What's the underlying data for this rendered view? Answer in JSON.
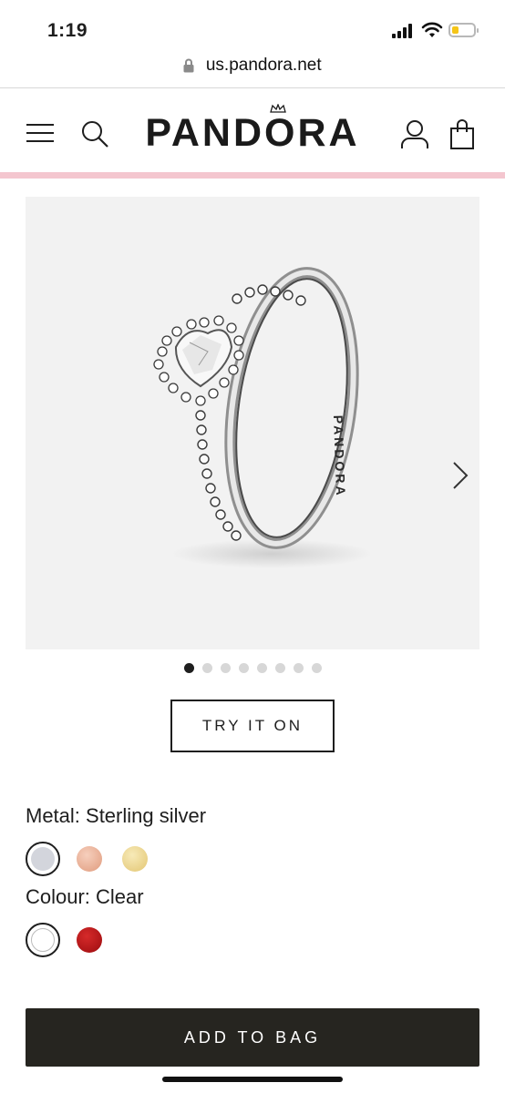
{
  "status_bar": {
    "time": "1:19",
    "battery_color": "#f5c518"
  },
  "browser": {
    "url": "us.pandora.net"
  },
  "header": {
    "logo_text": "PANDORA",
    "icons": [
      "menu-icon",
      "search-icon",
      "account-icon",
      "bag-icon"
    ],
    "accent_line_color": "#f4c6cf"
  },
  "gallery": {
    "image_count": 8,
    "active_index": 0,
    "next_icon": "chevron-right-icon",
    "engraving": "PANDORA"
  },
  "try_on": {
    "label": "TRY IT ON"
  },
  "options": {
    "metal_label": "Metal: Sterling silver",
    "metal_swatches": [
      {
        "name": "sterling-silver",
        "color": "#d3d5dc",
        "selected": true
      },
      {
        "name": "rose-gold",
        "color": "#e5a98e",
        "selected": false
      },
      {
        "name": "gold",
        "color": "#ecd58f",
        "selected": false
      }
    ],
    "colour_label": "Colour: Clear",
    "colour_swatches": [
      {
        "name": "clear",
        "color": "#ffffff",
        "selected": true
      },
      {
        "name": "red",
        "color": "#b00f14",
        "selected": false
      }
    ]
  },
  "cta": {
    "add_to_bag_label": "ADD TO BAG"
  }
}
